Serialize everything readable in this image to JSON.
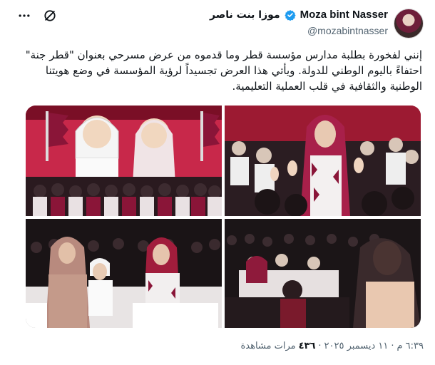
{
  "author": {
    "name_en": "Moza bint Nasser",
    "name_ar": "موزا بنت ناصر",
    "handle": "@mozabintnasser",
    "avatar_icon": "profile-photo"
  },
  "tweet": {
    "text": "إنني لفخورة بطلبة مدارس مؤسسة قطر وما قدموه من عرض مسرحي بعنوان \"قطر جنة\" احتفاءً باليوم الوطني للدولة. ويأتي هذا العرض تجسيداً لرؤية المؤسسة في وضع هويتنا الوطنية والثقافية في قلب العملية التعليمية.",
    "media_count": 4
  },
  "footer": {
    "time": "٦:٣٩ م",
    "date": "١١ ديسمبر ٢٠٢٥",
    "dot": "·",
    "views_count": "٤٣٦",
    "views_label": "مرات مشاهدة"
  },
  "colors": {
    "verified": "#1d9bf0",
    "text": "#0f1419",
    "secondary": "#536471",
    "maroon": "#8a1538"
  }
}
